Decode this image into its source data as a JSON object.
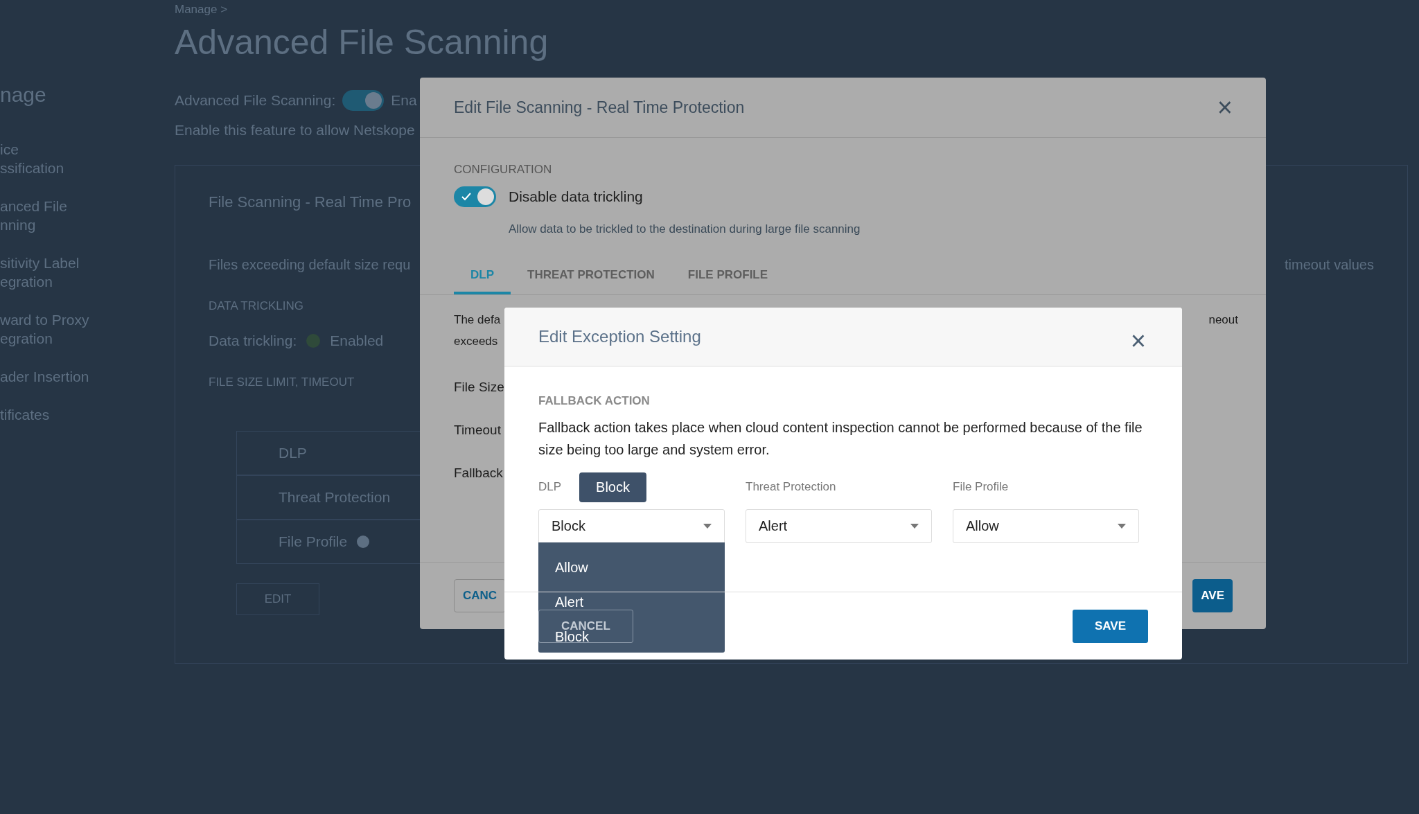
{
  "page": {
    "sidebar": {
      "title": "nage",
      "items": [
        [
          "ice",
          "ssification"
        ],
        [
          "anced File",
          "nning"
        ],
        [
          "sitivity Label",
          "egration"
        ],
        [
          "ward to Proxy",
          "egration"
        ],
        [
          "ader Insertion"
        ],
        [
          "tificates"
        ]
      ]
    },
    "breadcrumb": "Manage >",
    "title": "Advanced File Scanning",
    "feature_toggle": {
      "label": "Advanced File Scanning:",
      "on": true,
      "state_text": "Ena"
    },
    "description": "Enable this feature to allow Netskope",
    "card": {
      "title": "File Scanning - Real Time Pro",
      "note": "Files exceeding default size requ",
      "note_end": "timeout values",
      "trickling_heading": "DATA TRICKLING",
      "trickling_label": "Data trickling:",
      "trickling_status": {
        "text": "Enabled",
        "color": "#2f4a3a"
      },
      "limits_heading": "FILE SIZE LIMIT, TIMEOUT",
      "rows": [
        {
          "label": "DLP",
          "info": false
        },
        {
          "label": "Threat Protection",
          "info": false
        },
        {
          "label": "File Profile",
          "info": true
        }
      ],
      "edit_button": "EDIT"
    }
  },
  "edit_modal": {
    "title": "Edit File Scanning - Real Time Protection",
    "close": "×",
    "section_heading": "CONFIGURATION",
    "toggle": {
      "label": "Disable data trickling",
      "on": true,
      "hint": "Allow data to be trickled to the destination during large file scanning"
    },
    "tabs": [
      {
        "label": "DLP",
        "selected": true
      },
      {
        "label": "THREAT PROTECTION",
        "selected": false
      },
      {
        "label": "FILE PROFILE",
        "selected": false
      }
    ],
    "intro_lines": [
      "The defa",
      "exceeds"
    ],
    "intro_end": "neout",
    "fields": [
      "File Size",
      "Timeout",
      "Fallback"
    ],
    "buttons": [
      {
        "label": "CANC",
        "kind": "secondary"
      },
      {
        "label": "AVE",
        "kind": "primary"
      }
    ]
  },
  "exception_modal": {
    "title": "Edit Exception Setting",
    "close": "×",
    "section_heading": "FALLBACK ACTION",
    "text": "Fallback action takes place when cloud content inspection cannot be performed because of the file size being too large and system error.",
    "selects": [
      {
        "label": "DLP",
        "value": "Block",
        "open": true,
        "tooltip": "Block"
      },
      {
        "label": "Threat Protection",
        "value": "Alert",
        "open": false
      },
      {
        "label": "File Profile",
        "value": "Allow",
        "open": false
      }
    ],
    "options": [
      "Allow",
      "Alert",
      "Block"
    ],
    "buttons": [
      {
        "label": "CANCEL",
        "kind": "secondary"
      },
      {
        "label": "SAVE",
        "kind": "primary"
      }
    ]
  }
}
